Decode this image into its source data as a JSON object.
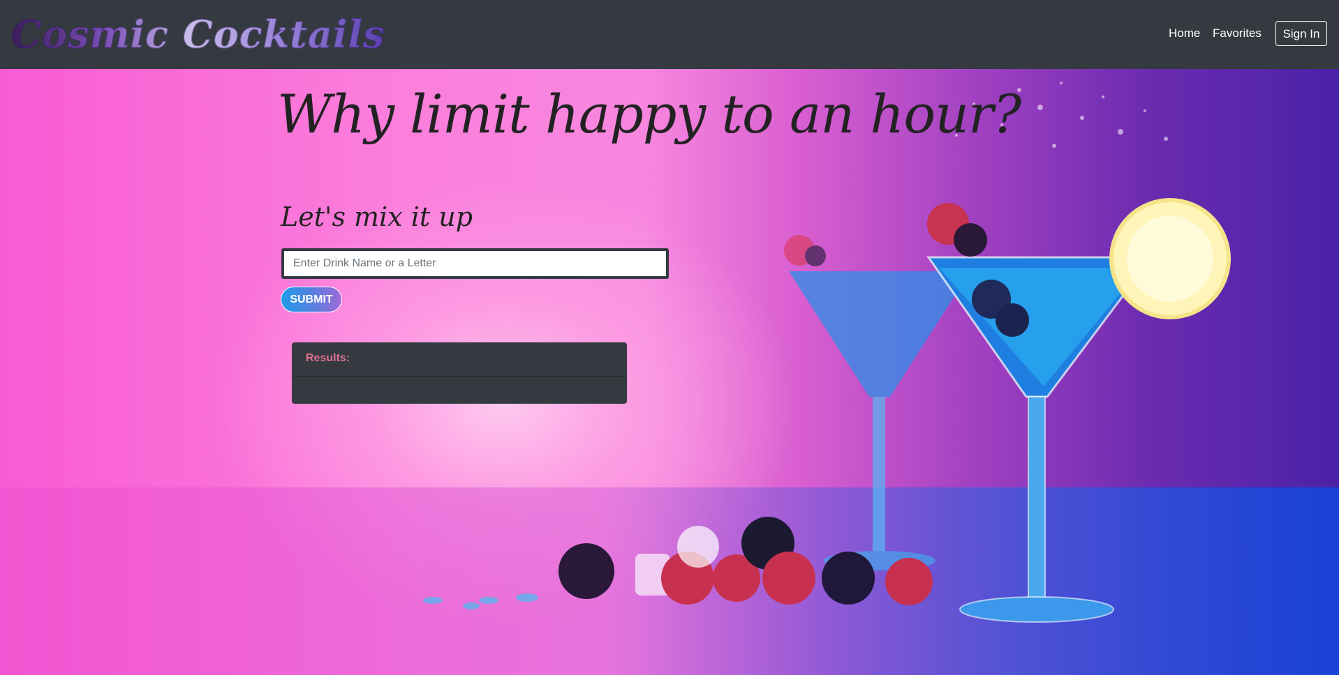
{
  "navbar": {
    "brand": "Cosmic Cocktails",
    "links": [
      {
        "label": "Home"
      },
      {
        "label": "Favorites"
      }
    ],
    "signin_label": "Sign In"
  },
  "hero": {
    "title": "Why limit happy to an hour?",
    "subtitle": "Let's mix it up",
    "search": {
      "placeholder": "Enter Drink Name or a Letter",
      "value": ""
    },
    "submit_label": "SUBMIT",
    "results": {
      "label": "Results:"
    }
  },
  "colors": {
    "navbar_bg": "#343a40",
    "hero_pink": "#f95bd3",
    "hero_purple": "#4a22a8",
    "results_label": "#e0708f",
    "submit_gradient_start": "#1f9be8",
    "submit_gradient_end": "#a26ad8"
  }
}
